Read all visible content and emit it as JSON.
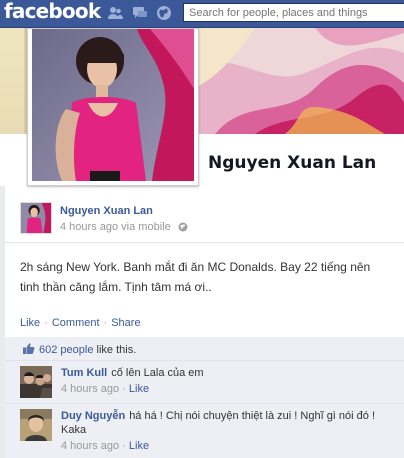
{
  "topbar": {
    "logo": "facebook",
    "search_placeholder": "Search for people, places and things",
    "jewels": [
      "friend-requests-icon",
      "messages-icon",
      "notifications-globe-icon"
    ]
  },
  "profile": {
    "name": "Nguyen Xuan Lan"
  },
  "post": {
    "author": "Nguyen Xuan Lan",
    "time": "4 hours ago",
    "via": "via mobile",
    "text_line1": "2h sáng New York. Banh mắt đi ăn MC Donalds. Bay 22 tiếng nên",
    "text_line2": "tinh thần căng lắm. Tịnh tâm má ơi..",
    "actions": {
      "like": "Like",
      "comment": "Comment",
      "share": "Share",
      "sep": "·"
    }
  },
  "likes": {
    "count_text": "602 people",
    "suffix": "like this."
  },
  "comments": [
    {
      "author": "Tum Kull",
      "text": "cố lên Lala của em",
      "time": "4 hours ago",
      "like": "Like"
    },
    {
      "author": "Duy Nguyễn",
      "text": "há há ! Chị nói chuyện thiệt là zui ! Nghĩ gì nói đó ! Kaka",
      "time": "4 hours ago",
      "like": "Like"
    }
  ],
  "colors": {
    "brand": "#3b5998",
    "ufi_background": "#edeff4",
    "meta_text": "#999999"
  }
}
